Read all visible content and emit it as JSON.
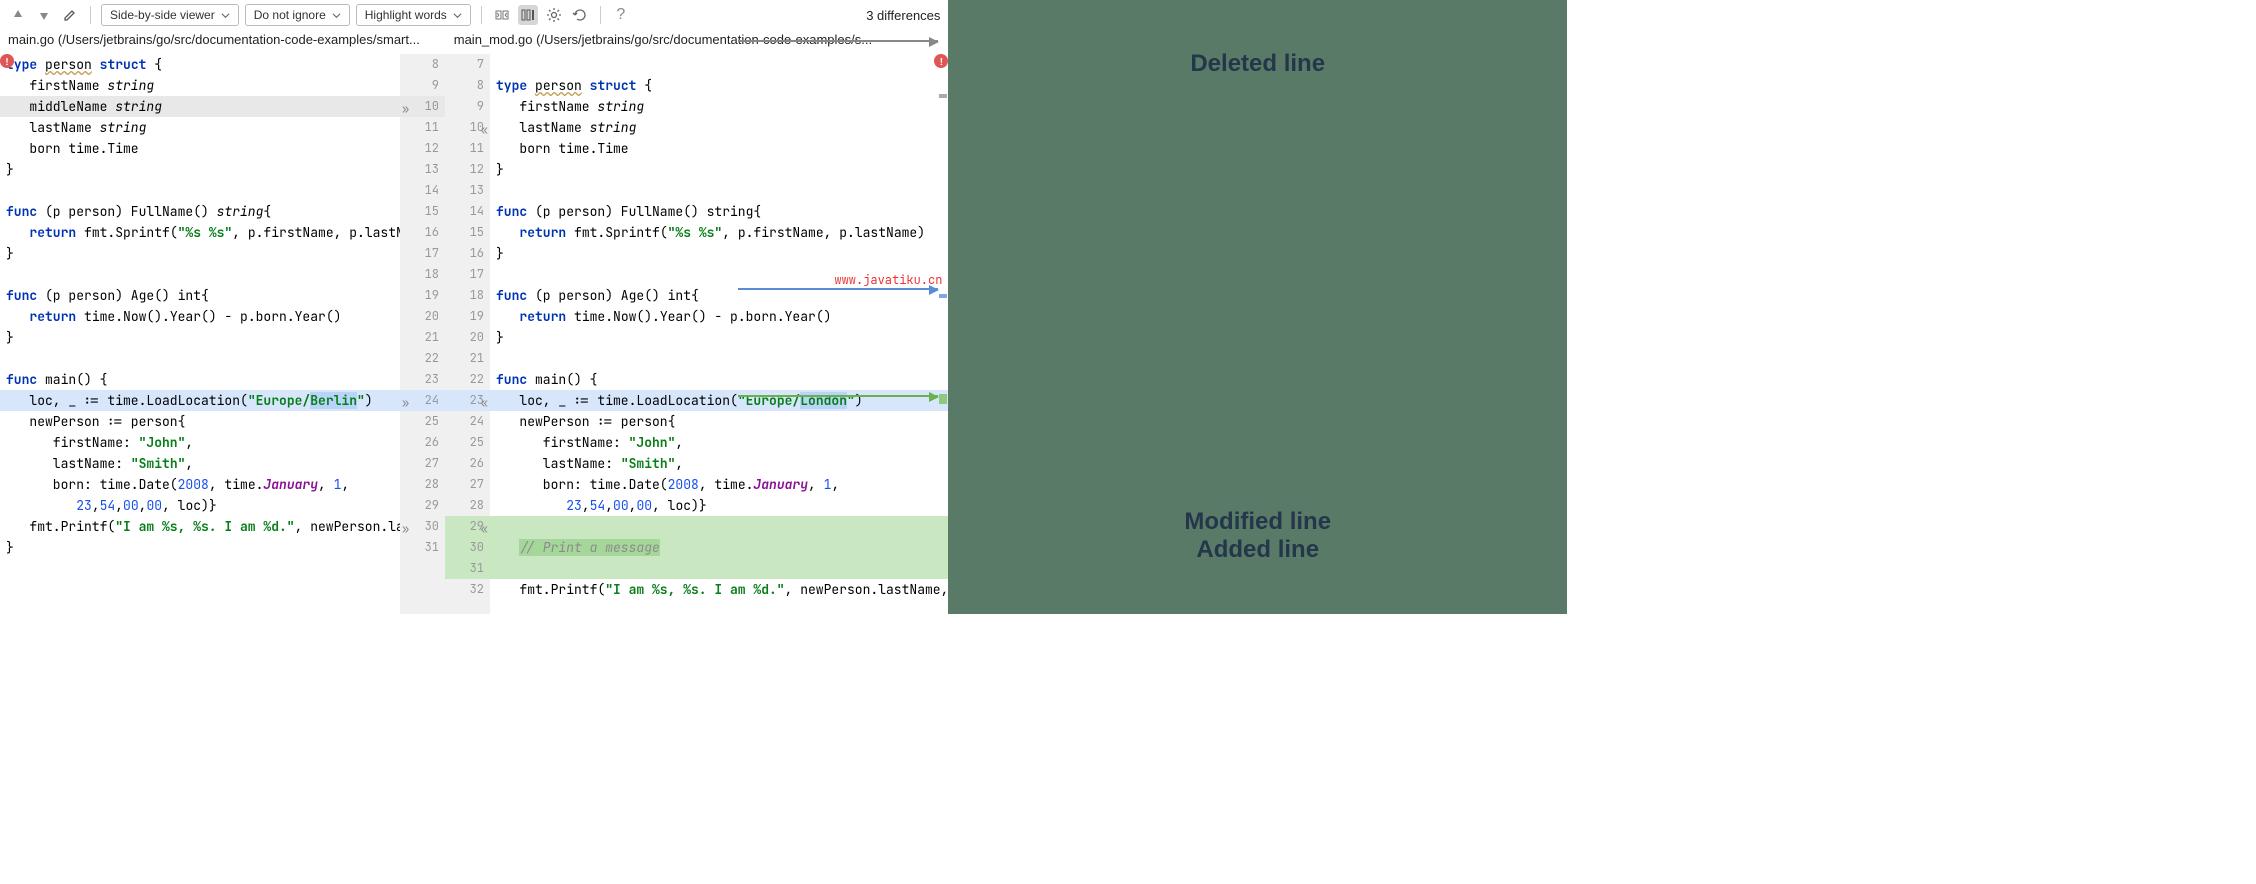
{
  "toolbar": {
    "viewer_mode": "Side-by-side viewer",
    "ignore_mode": "Do not ignore",
    "highlight_mode": "Highlight words",
    "diff_count": "3 differences"
  },
  "files": {
    "left": "main.go (/Users/jetbrains/go/src/documentation-code-examples/smart...",
    "right": "main_mod.go (/Users/jetbrains/go/src/documentation-code-examples/s..."
  },
  "watermark": "www.javatiku.cn",
  "annotations": {
    "deleted": "Deleted line",
    "modified": "Modified line",
    "added": "Added line"
  },
  "code_left": [
    {
      "n": 8,
      "bg": "",
      "tokens": [
        {
          "t": "type ",
          "c": "kw"
        },
        {
          "t": "person",
          "c": "uline"
        },
        {
          "t": " "
        },
        {
          "t": "struct",
          "c": "kw"
        },
        {
          "t": " {"
        }
      ]
    },
    {
      "n": 9,
      "bg": "",
      "tokens": [
        {
          "t": "   firstName "
        },
        {
          "t": "string",
          "c": "typ"
        }
      ]
    },
    {
      "n": 10,
      "bg": "bg-deleted",
      "chev": "»",
      "tokens": [
        {
          "t": "   middleName "
        },
        {
          "t": "string",
          "c": "typ"
        }
      ]
    },
    {
      "n": 11,
      "bg": "",
      "tokens": [
        {
          "t": "   lastName "
        },
        {
          "t": "string",
          "c": "typ"
        }
      ]
    },
    {
      "n": 12,
      "bg": "",
      "tokens": [
        {
          "t": "   born time.Time"
        }
      ]
    },
    {
      "n": 13,
      "bg": "",
      "tokens": [
        {
          "t": "}"
        }
      ]
    },
    {
      "n": 14,
      "bg": "",
      "tokens": [
        {
          "t": ""
        }
      ]
    },
    {
      "n": 15,
      "bg": "",
      "tokens": [
        {
          "t": "func",
          "c": "kw"
        },
        {
          "t": " (p person) FullName() "
        },
        {
          "t": "string",
          "c": "typ"
        },
        {
          "t": "{"
        }
      ]
    },
    {
      "n": 16,
      "bg": "",
      "tokens": [
        {
          "t": "   "
        },
        {
          "t": "return",
          "c": "kw"
        },
        {
          "t": " fmt.Sprintf("
        },
        {
          "t": "\"%s %s\"",
          "c": "str"
        },
        {
          "t": ", p.firstName, p.lastName)"
        }
      ]
    },
    {
      "n": 17,
      "bg": "",
      "tokens": [
        {
          "t": "}"
        }
      ]
    },
    {
      "n": 18,
      "bg": "",
      "tokens": [
        {
          "t": ""
        }
      ]
    },
    {
      "n": 19,
      "bg": "",
      "tokens": [
        {
          "t": "func",
          "c": "kw"
        },
        {
          "t": " (p person) Age() int{"
        }
      ]
    },
    {
      "n": 20,
      "bg": "",
      "tokens": [
        {
          "t": "   "
        },
        {
          "t": "return",
          "c": "kw"
        },
        {
          "t": " time.Now().Year() - p.born.Year()"
        }
      ]
    },
    {
      "n": 21,
      "bg": "",
      "tokens": [
        {
          "t": "}"
        }
      ]
    },
    {
      "n": 22,
      "bg": "",
      "tokens": [
        {
          "t": ""
        }
      ]
    },
    {
      "n": 23,
      "bg": "",
      "tokens": [
        {
          "t": "func",
          "c": "kw"
        },
        {
          "t": " main() {"
        }
      ]
    },
    {
      "n": 24,
      "bg": "bg-modified",
      "chev": "»",
      "tokens": [
        {
          "t": "   loc, _ := time.LoadLocation("
        },
        {
          "t": "\"Europe/",
          "c": "str"
        },
        {
          "t": "Berlin",
          "c": "str hl-word"
        },
        {
          "t": "\"",
          "c": "str"
        },
        {
          "t": ")"
        }
      ]
    },
    {
      "n": 25,
      "bg": "",
      "tokens": [
        {
          "t": "   newPerson := person{"
        }
      ]
    },
    {
      "n": 26,
      "bg": "",
      "tokens": [
        {
          "t": "      firstName: "
        },
        {
          "t": "\"John\"",
          "c": "str"
        },
        {
          "t": ","
        }
      ]
    },
    {
      "n": 27,
      "bg": "",
      "tokens": [
        {
          "t": "      lastName: "
        },
        {
          "t": "\"Smith\"",
          "c": "str"
        },
        {
          "t": ","
        }
      ]
    },
    {
      "n": 28,
      "bg": "",
      "tokens": [
        {
          "t": "      born: time.Date("
        },
        {
          "t": "2008",
          "c": "num"
        },
        {
          "t": ", time."
        },
        {
          "t": "January",
          "c": "ital"
        },
        {
          "t": ", "
        },
        {
          "t": "1",
          "c": "num"
        },
        {
          "t": ","
        }
      ]
    },
    {
      "n": 29,
      "bg": "",
      "tokens": [
        {
          "t": "         "
        },
        {
          "t": "23",
          "c": "num"
        },
        {
          "t": ","
        },
        {
          "t": "54",
          "c": "num"
        },
        {
          "t": ","
        },
        {
          "t": "00",
          "c": "num"
        },
        {
          "t": ","
        },
        {
          "t": "00",
          "c": "num"
        },
        {
          "t": ", loc)}"
        }
      ]
    },
    {
      "n": 30,
      "bg": "",
      "chev": "»",
      "tokens": [
        {
          "t": "   fmt.Printf("
        },
        {
          "t": "\"I am %s, %s. I am %d.\"",
          "c": "str"
        },
        {
          "t": ", newPerson.lastNa"
        }
      ]
    },
    {
      "n": 31,
      "bg": "",
      "tokens": [
        {
          "t": "}"
        }
      ]
    }
  ],
  "code_right": [
    {
      "n": 7,
      "bg": "",
      "tokens": [
        {
          "t": ""
        }
      ]
    },
    {
      "n": 8,
      "bg": "",
      "tokens": [
        {
          "t": "type ",
          "c": "kw"
        },
        {
          "t": "person",
          "c": "uline"
        },
        {
          "t": " "
        },
        {
          "t": "struct",
          "c": "kw"
        },
        {
          "t": " {"
        }
      ]
    },
    {
      "n": 9,
      "bg": "",
      "tokens": [
        {
          "t": "   firstName "
        },
        {
          "t": "string",
          "c": "typ"
        }
      ]
    },
    {
      "n": 10,
      "bg": "",
      "chev": "«",
      "tokens": [
        {
          "t": "   lastName "
        },
        {
          "t": "string",
          "c": "typ"
        }
      ]
    },
    {
      "n": 11,
      "bg": "",
      "tokens": [
        {
          "t": "   born time.Time"
        }
      ]
    },
    {
      "n": 12,
      "bg": "",
      "tokens": [
        {
          "t": "}"
        }
      ]
    },
    {
      "n": 13,
      "bg": "",
      "tokens": [
        {
          "t": ""
        }
      ]
    },
    {
      "n": 14,
      "bg": "",
      "tokens": [
        {
          "t": "func",
          "c": "kw"
        },
        {
          "t": " (p person) FullName() string{"
        }
      ]
    },
    {
      "n": 15,
      "bg": "",
      "tokens": [
        {
          "t": "   "
        },
        {
          "t": "return",
          "c": "kw"
        },
        {
          "t": " fmt.Sprintf("
        },
        {
          "t": "\"%s %s\"",
          "c": "str"
        },
        {
          "t": ", p.firstName, p.lastName)"
        }
      ]
    },
    {
      "n": 16,
      "bg": "",
      "tokens": [
        {
          "t": "}"
        }
      ]
    },
    {
      "n": 17,
      "bg": "",
      "tokens": [
        {
          "t": ""
        }
      ]
    },
    {
      "n": 18,
      "bg": "",
      "tokens": [
        {
          "t": "func",
          "c": "kw"
        },
        {
          "t": " (p person) Age() int{"
        }
      ]
    },
    {
      "n": 19,
      "bg": "",
      "tokens": [
        {
          "t": "   "
        },
        {
          "t": "return",
          "c": "kw"
        },
        {
          "t": " time.Now().Year() - p.born.Year()"
        }
      ]
    },
    {
      "n": 20,
      "bg": "",
      "tokens": [
        {
          "t": "}"
        }
      ]
    },
    {
      "n": 21,
      "bg": "",
      "tokens": [
        {
          "t": ""
        }
      ]
    },
    {
      "n": 22,
      "bg": "",
      "tokens": [
        {
          "t": "func",
          "c": "kw"
        },
        {
          "t": " main() {"
        }
      ]
    },
    {
      "n": 23,
      "bg": "bg-modified",
      "chev": "«",
      "tokens": [
        {
          "t": "   loc, _ := time.LoadLocation("
        },
        {
          "t": "\"Europe/",
          "c": "str"
        },
        {
          "t": "London",
          "c": "str hl-word"
        },
        {
          "t": "\"",
          "c": "str"
        },
        {
          "t": ")"
        }
      ]
    },
    {
      "n": 24,
      "bg": "",
      "tokens": [
        {
          "t": "   newPerson := person{"
        }
      ]
    },
    {
      "n": 25,
      "bg": "",
      "tokens": [
        {
          "t": "      firstName: "
        },
        {
          "t": "\"John\"",
          "c": "str"
        },
        {
          "t": ","
        }
      ]
    },
    {
      "n": 26,
      "bg": "",
      "tokens": [
        {
          "t": "      lastName: "
        },
        {
          "t": "\"Smith\"",
          "c": "str"
        },
        {
          "t": ","
        }
      ]
    },
    {
      "n": 27,
      "bg": "",
      "tokens": [
        {
          "t": "      born: time.Date("
        },
        {
          "t": "2008",
          "c": "num"
        },
        {
          "t": ", time."
        },
        {
          "t": "January",
          "c": "ital"
        },
        {
          "t": ", "
        },
        {
          "t": "1",
          "c": "num"
        },
        {
          "t": ","
        }
      ]
    },
    {
      "n": 28,
      "bg": "",
      "tokens": [
        {
          "t": "         "
        },
        {
          "t": "23",
          "c": "num"
        },
        {
          "t": ","
        },
        {
          "t": "54",
          "c": "num"
        },
        {
          "t": ","
        },
        {
          "t": "00",
          "c": "num"
        },
        {
          "t": ","
        },
        {
          "t": "00",
          "c": "num"
        },
        {
          "t": ", loc)}"
        }
      ]
    },
    {
      "n": 29,
      "bg": "bg-added",
      "chev": "«",
      "tokens": [
        {
          "t": ""
        }
      ]
    },
    {
      "n": 30,
      "bg": "bg-added",
      "tokens": [
        {
          "t": "   "
        },
        {
          "t": "// Print a message",
          "c": "cmt hl-word-g"
        }
      ]
    },
    {
      "n": 31,
      "bg": "bg-added",
      "tokens": [
        {
          "t": ""
        }
      ]
    },
    {
      "n": 32,
      "bg": "",
      "tokens": [
        {
          "t": "   fmt.Printf("
        },
        {
          "t": "\"I am %s, %s. I am %d.\"",
          "c": "str"
        },
        {
          "t": ", newPerson.lastName,"
        }
      ]
    }
  ]
}
